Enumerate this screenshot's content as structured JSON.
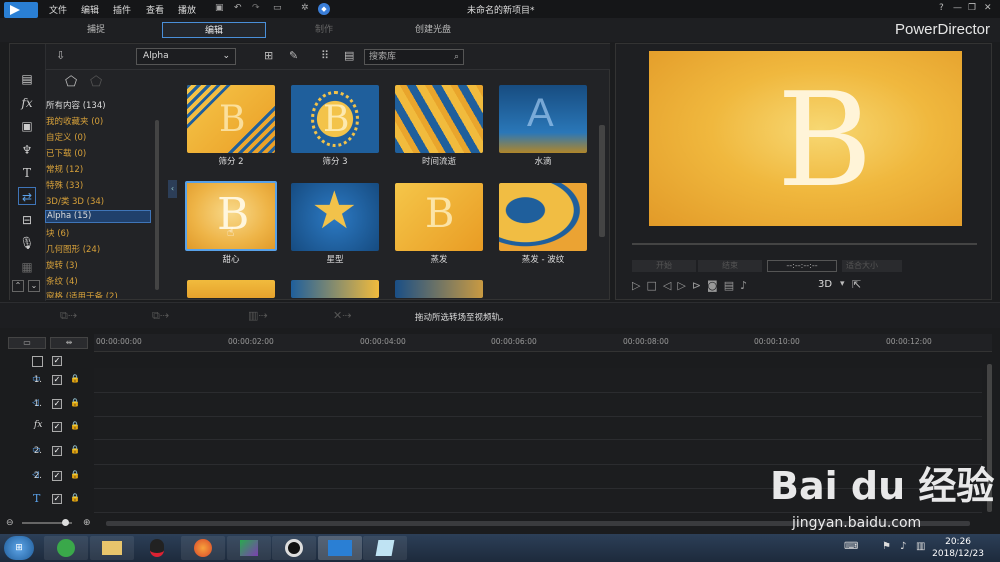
{
  "menu": {
    "items": [
      "文件",
      "编辑",
      "插件",
      "查看",
      "播放"
    ],
    "title": "未命名的新项目*"
  },
  "modes": {
    "tabs": [
      "捕捉",
      "编辑",
      "制作",
      "创建光盘"
    ],
    "brand": "PowerDirector"
  },
  "library": {
    "dropdown": "Alpha",
    "search_placeholder": "搜索库",
    "categories": [
      "所有内容 (134)",
      "我的收藏夹 (0)",
      "自定义 (0)",
      "已下载 (0)",
      "常规 (12)",
      "特殊 (33)",
      "3D/类 3D (34)",
      "Alpha (15)",
      "块 (6)",
      "几何图形 (24)",
      "旋转 (3)",
      "条纹 (4)",
      "窗格 (适用于备 (2)"
    ],
    "thumbs": [
      {
        "label": "筛分 2",
        "style": "a"
      },
      {
        "label": "筛分 3",
        "style": "b"
      },
      {
        "label": "时间流逝",
        "style": "c"
      },
      {
        "label": "水滴",
        "style": "d"
      },
      {
        "label": "甜心",
        "style": "e"
      },
      {
        "label": "星型",
        "style": "f"
      },
      {
        "label": "蒸发",
        "style": "g"
      },
      {
        "label": "蒸发 - 波纹",
        "style": "h"
      }
    ]
  },
  "preview": {
    "glyph": "B",
    "btn1": "开始",
    "btn2": "结束",
    "timecode": "--:--:--:--",
    "size": "适合大小",
    "mode3d": "3D"
  },
  "editbar": {
    "hint": "拖动所选转场至视频轨。"
  },
  "timeline": {
    "ticks": [
      "00:00:00:00",
      "00:00:02:00",
      "00:00:04:00",
      "00:00:06:00",
      "00:00:08:00",
      "00:00:10:00",
      "00:00:12:00"
    ],
    "tracks": [
      "1.",
      "1.",
      "",
      "2.",
      "2.",
      "",
      ""
    ]
  },
  "taskbar": {
    "time": "20:26",
    "date": "2018/12/23"
  },
  "watermark": {
    "brand": "Bai du 经验",
    "url": "jingyan.baidu.com"
  }
}
